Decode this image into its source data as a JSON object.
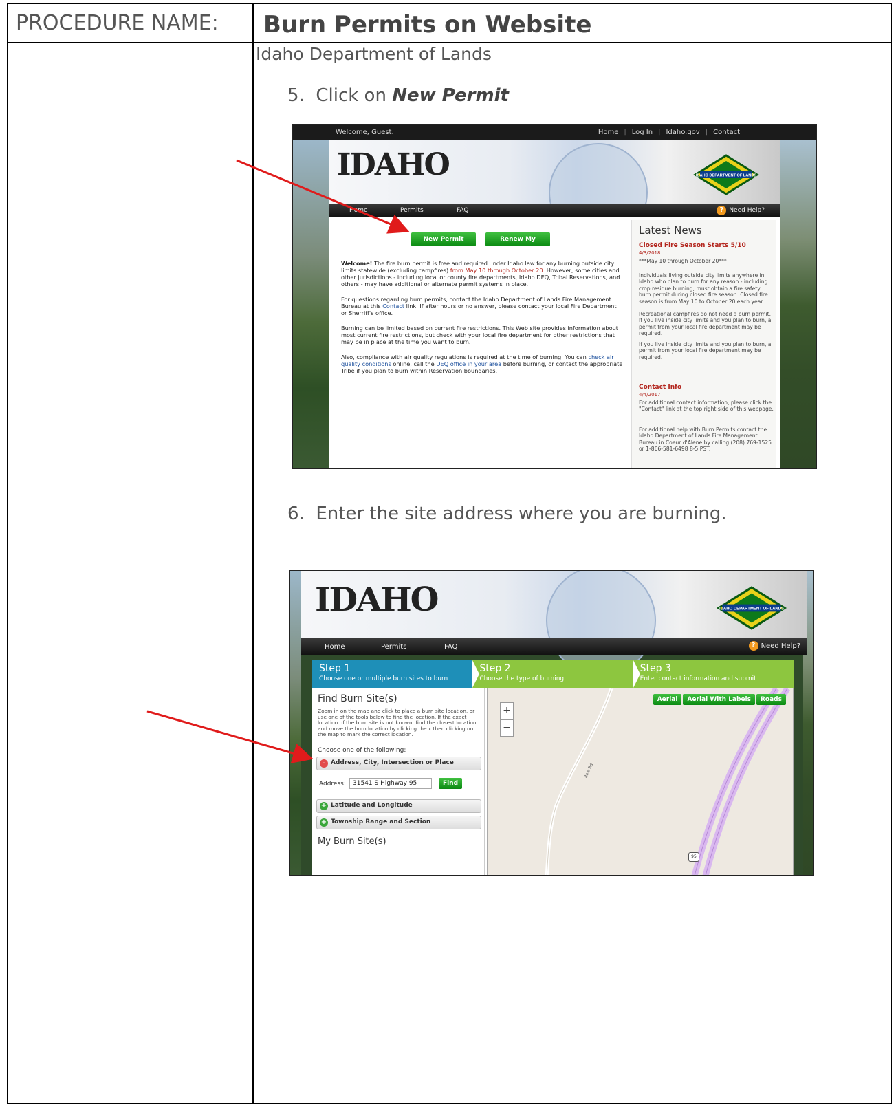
{
  "doc": {
    "procedure_label": "PROCEDURE NAME:",
    "procedure_title": "Burn Permits on Website",
    "organization": "Idaho Department of Lands",
    "step5_prefix": "5.  Click on ",
    "step5_emph": "New Permit",
    "step6": "6.  Enter the site address where you are burning."
  },
  "shot1": {
    "welcome": "Welcome, Guest.",
    "top_links": [
      "Home",
      "Log In",
      "Idaho.gov",
      "Contact"
    ],
    "logo_text": "IDAHO",
    "idl_logo_text": "IDAHO DEPARTMENT OF LANDS",
    "nav": [
      "Home",
      "Permits",
      "FAQ"
    ],
    "help": "Need Help?",
    "btn_new": "New Permit",
    "btn_renew": "Renew My Permits",
    "p1_bold": "Welcome!",
    "p1_a": " The fire burn permit is free and required under Idaho law for any burning outside city limits statewide (excluding campfires) ",
    "p1_red": "from May 10 through October 20",
    "p1_b": ". However, some cities and other jurisdictions - including local or county fire departments, Idaho DEQ, Tribal Reservations, and others - may have additional or alternate permit systems in place.",
    "p2_a": "For questions regarding burn permits, contact the Idaho Department of Lands Fire Management Bureau at this ",
    "p2_link": "Contact",
    "p2_b": " link. If after hours or no answer, please contact your local Fire Department or Sherriff's office.",
    "p3": "Burning can be limited based on current fire restrictions. This Web site provides information about most current fire restrictions, but check with your local fire department for other restrictions that may be in place at the time you want to burn.",
    "p4_a": "Also, compliance with air quality regulations is required at the time of burning. You can ",
    "p4_link1": "check air quality conditions",
    "p4_b": " online, call the ",
    "p4_link2": "DEQ office in your area",
    "p4_c": " before burning, or contact the appropriate Tribe if you plan to burn within Reservation boundaries.",
    "news_heading": "Latest News",
    "news1_title": "Closed Fire Season Starts 5/10",
    "news1_date": "4/3/2018",
    "news1_sub": "***May 10 through October 20***",
    "news1_p1": "Individuals living outside city limits anywhere in Idaho who plan to burn for any reason - including crop residue burning, must obtain a fire safety burn permit during closed fire season. Closed fire season is from May 10 to October 20 each year.",
    "news1_p2": "Recreational campfires do not need a burn permit. If you live inside city limits and you plan to burn, a permit from your local fire department may be required.",
    "news1_p3": "If you live inside city limits and you plan to burn, a permit from your local fire department may be required.",
    "news2_title": "Contact Info",
    "news2_date": "4/4/2017",
    "news2_p1": "For additional contact information, please click the \"Contact\" link at the top right side of this webpage.",
    "news2_p2": "For additional help with Burn Permits contact the Idaho Department of Lands Fire Management Bureau in Coeur d'Alene by calling (208) 769-1525 or 1-866-581-6498 8-5 PST."
  },
  "shot2": {
    "logo_text": "IDAHO",
    "idl_logo_text": "IDAHO DEPARTMENT OF LANDS",
    "nav": [
      "Home",
      "Permits",
      "FAQ"
    ],
    "help": "Need Help?",
    "steps": [
      {
        "title": "Step 1",
        "sub": "Choose one or multiple burn sites to burn"
      },
      {
        "title": "Step 2",
        "sub": "Choose the type of burning"
      },
      {
        "title": "Step 3",
        "sub": "Enter contact information and submit"
      }
    ],
    "find_heading": "Find Burn Site(s)",
    "find_desc": "Zoom in on the map and click to place a burn site location, or use one of the tools below to find the location. If the exact location of the burn site is not known, find the closest location and move the burn location by clicking the x then clicking on the map to mark the correct location.",
    "choose": "Choose one of the following:",
    "acc1": "Address, City, Intersection or Place",
    "address_label": "Address:",
    "address_value": "31541 S Highway 95",
    "find_btn": "Find",
    "acc2": "Latitude and Longitude",
    "acc3": "Township Range and Section",
    "my_sites": "My Burn Site(s)",
    "map_btns": [
      "Aerial",
      "Aerial With Labels",
      "Roads"
    ],
    "zoom_in": "+",
    "zoom_out": "−",
    "road_label": "Rew Rd",
    "hwy": "95"
  }
}
